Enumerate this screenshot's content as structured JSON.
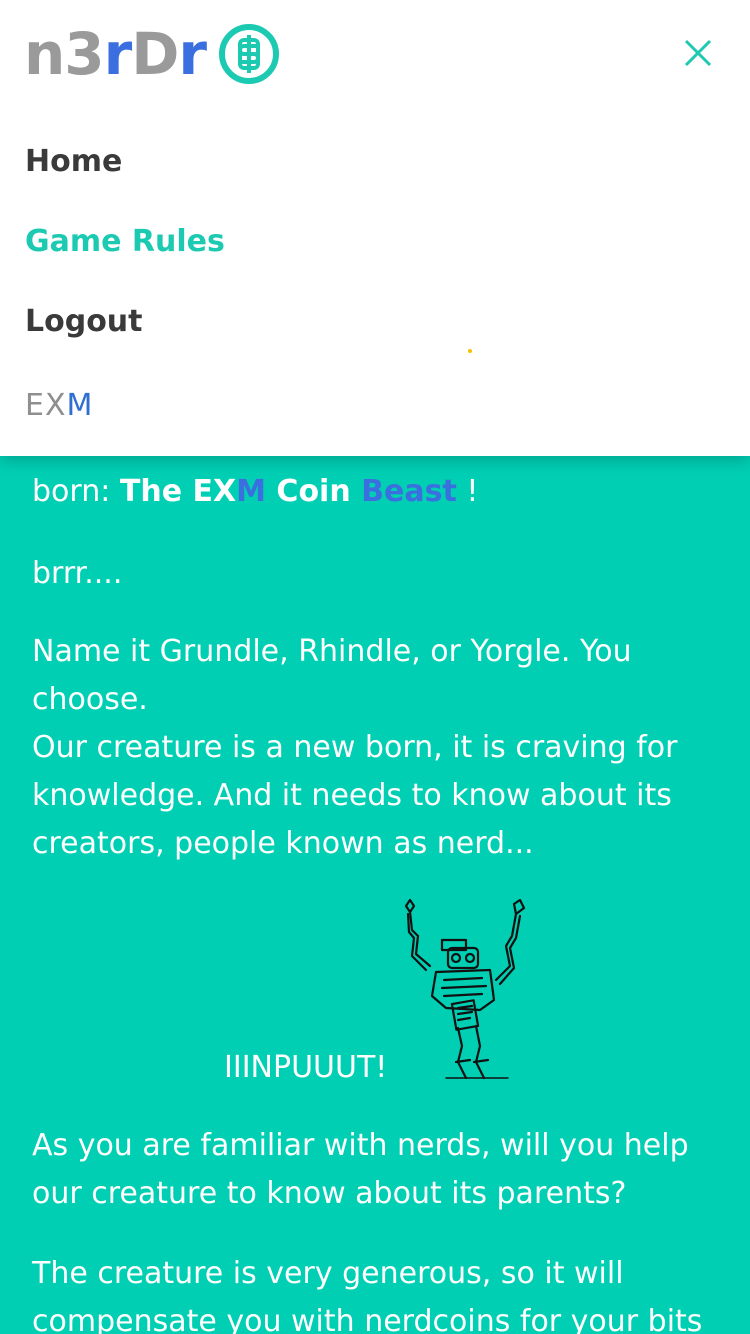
{
  "logo": {
    "part1": "n3",
    "part2": "r",
    "part3": "D",
    "part4": "r",
    "coin_symbol": "$"
  },
  "menu": {
    "items": [
      {
        "label": "Home"
      },
      {
        "label": "Game Rules"
      },
      {
        "label": "Logout"
      }
    ],
    "exm_logo": {
      "ex": "EX",
      "m": "M"
    }
  },
  "content": {
    "hidden_line": "",
    "line1_prefix": "born: ",
    "line1_the_ex": "The EX",
    "line1_m": "M",
    "line1_coin": " Coin ",
    "line1_beast": "Beast",
    "line1_suffix": " !",
    "brrr": "brrr....",
    "para_name": "Name it Grundle, Rhindle, or Yorgle. You choose.",
    "para_creature": "Our creature is a new born, it is craving for knowledge. And it needs to know about its creators, people known as nerd...",
    "input_shout": "IIINPUUUT!",
    "para_help": "As you are familiar with nerds, will you help our creature to know about its parents?",
    "para_generous": "The creature is very generous, so it will compensate you with nerdcoins for your bits of"
  },
  "colors": {
    "background": "#00cfb4",
    "accent": "#1cc9b1",
    "blue": "#3b6fe0",
    "menu_text": "#3a3a3a"
  }
}
